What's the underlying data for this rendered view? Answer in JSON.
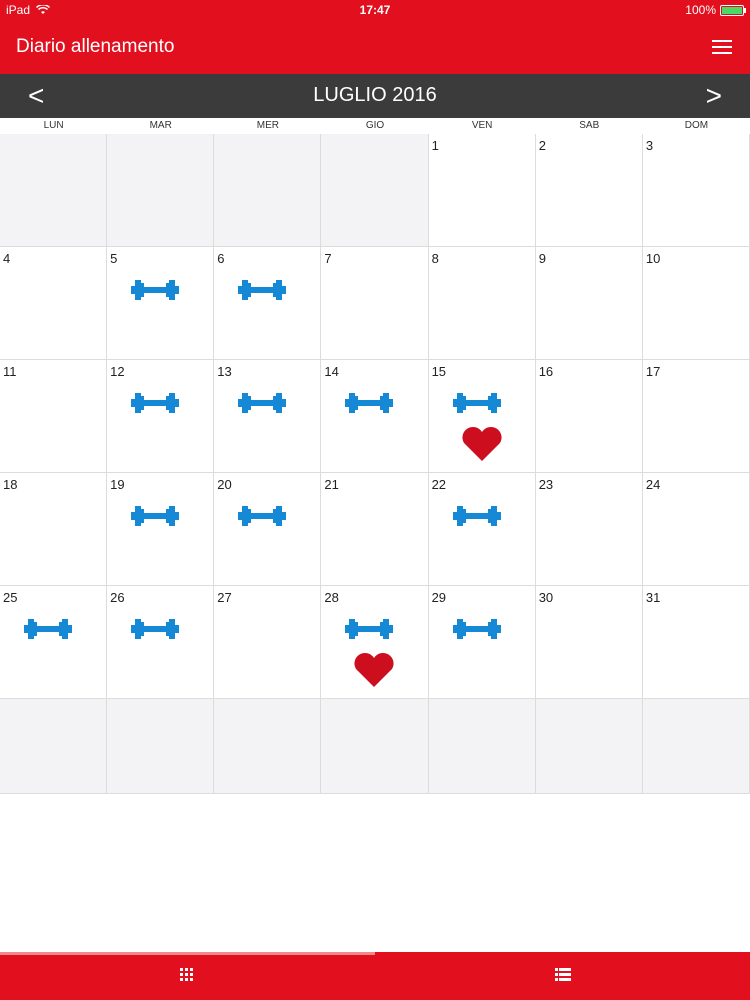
{
  "status": {
    "device": "iPad",
    "time": "17:47",
    "battery": "100%"
  },
  "app": {
    "title": "Diario allenamento"
  },
  "calendar": {
    "month": "LUGLIO 2016",
    "prev": "<",
    "next": ">",
    "weekdays": [
      "LUN",
      "MAR",
      "MER",
      "GIO",
      "VEN",
      "SAB",
      "DOM"
    ],
    "weeks": [
      [
        {
          "day": ""
        },
        {
          "day": ""
        },
        {
          "day": ""
        },
        {
          "day": ""
        },
        {
          "day": "1"
        },
        {
          "day": "2"
        },
        {
          "day": "3"
        }
      ],
      [
        {
          "day": "4"
        },
        {
          "day": "5",
          "workout": true
        },
        {
          "day": "6",
          "workout": true
        },
        {
          "day": "7"
        },
        {
          "day": "8"
        },
        {
          "day": "9"
        },
        {
          "day": "10"
        }
      ],
      [
        {
          "day": "11"
        },
        {
          "day": "12",
          "workout": true
        },
        {
          "day": "13",
          "workout": true
        },
        {
          "day": "14",
          "workout": true
        },
        {
          "day": "15",
          "workout": true,
          "heart": true
        },
        {
          "day": "16"
        },
        {
          "day": "17"
        }
      ],
      [
        {
          "day": "18"
        },
        {
          "day": "19",
          "workout": true
        },
        {
          "day": "20",
          "workout": true
        },
        {
          "day": "21"
        },
        {
          "day": "22",
          "workout": true
        },
        {
          "day": "23"
        },
        {
          "day": "24"
        }
      ],
      [
        {
          "day": "25",
          "workout": true
        },
        {
          "day": "26",
          "workout": true
        },
        {
          "day": "27"
        },
        {
          "day": "28",
          "workout": true,
          "heart": true
        },
        {
          "day": "29",
          "workout": true
        },
        {
          "day": "30"
        },
        {
          "day": "31"
        }
      ],
      [
        {
          "day": ""
        },
        {
          "day": ""
        },
        {
          "day": ""
        },
        {
          "day": ""
        },
        {
          "day": ""
        },
        {
          "day": ""
        },
        {
          "day": ""
        }
      ]
    ]
  },
  "colors": {
    "accent": "#e2101e",
    "workout": "#1689d6",
    "heart": "#cc0e1f",
    "header": "#3b3b3c"
  },
  "icons": {
    "workout": "dumbbell-icon",
    "heart": "heart-icon",
    "tab_grid": "grid-icon",
    "tab_list": "list-icon"
  }
}
